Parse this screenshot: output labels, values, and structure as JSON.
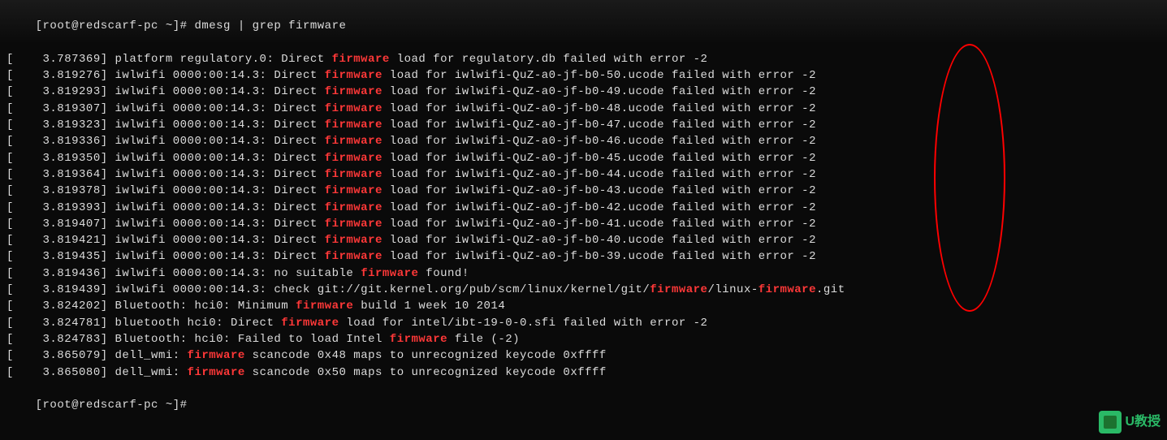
{
  "prompt": {
    "user_host": "[root@redscarf-pc ~]#",
    "command": "dmesg | grep firmware"
  },
  "lines": [
    {
      "time": "3.787369",
      "pre": "platform regulatory.0: Direct ",
      "hl": "firmware",
      "post": " load for regulatory.db failed with error -2"
    },
    {
      "time": "3.819276",
      "pre": "iwlwifi 0000:00:14.3: Direct ",
      "hl": "firmware",
      "post": " load for iwlwifi-QuZ-a0-jf-b0-50.ucode failed with error -2"
    },
    {
      "time": "3.819293",
      "pre": "iwlwifi 0000:00:14.3: Direct ",
      "hl": "firmware",
      "post": " load for iwlwifi-QuZ-a0-jf-b0-49.ucode failed with error -2"
    },
    {
      "time": "3.819307",
      "pre": "iwlwifi 0000:00:14.3: Direct ",
      "hl": "firmware",
      "post": " load for iwlwifi-QuZ-a0-jf-b0-48.ucode failed with error -2"
    },
    {
      "time": "3.819323",
      "pre": "iwlwifi 0000:00:14.3: Direct ",
      "hl": "firmware",
      "post": " load for iwlwifi-QuZ-a0-jf-b0-47.ucode failed with error -2"
    },
    {
      "time": "3.819336",
      "pre": "iwlwifi 0000:00:14.3: Direct ",
      "hl": "firmware",
      "post": " load for iwlwifi-QuZ-a0-jf-b0-46.ucode failed with error -2"
    },
    {
      "time": "3.819350",
      "pre": "iwlwifi 0000:00:14.3: Direct ",
      "hl": "firmware",
      "post": " load for iwlwifi-QuZ-a0-jf-b0-45.ucode failed with error -2"
    },
    {
      "time": "3.819364",
      "pre": "iwlwifi 0000:00:14.3: Direct ",
      "hl": "firmware",
      "post": " load for iwlwifi-QuZ-a0-jf-b0-44.ucode failed with error -2"
    },
    {
      "time": "3.819378",
      "pre": "iwlwifi 0000:00:14.3: Direct ",
      "hl": "firmware",
      "post": " load for iwlwifi-QuZ-a0-jf-b0-43.ucode failed with error -2"
    },
    {
      "time": "3.819393",
      "pre": "iwlwifi 0000:00:14.3: Direct ",
      "hl": "firmware",
      "post": " load for iwlwifi-QuZ-a0-jf-b0-42.ucode failed with error -2"
    },
    {
      "time": "3.819407",
      "pre": "iwlwifi 0000:00:14.3: Direct ",
      "hl": "firmware",
      "post": " load for iwlwifi-QuZ-a0-jf-b0-41.ucode failed with error -2"
    },
    {
      "time": "3.819421",
      "pre": "iwlwifi 0000:00:14.3: Direct ",
      "hl": "firmware",
      "post": " load for iwlwifi-QuZ-a0-jf-b0-40.ucode failed with error -2"
    },
    {
      "time": "3.819435",
      "pre": "iwlwifi 0000:00:14.3: Direct ",
      "hl": "firmware",
      "post": " load for iwlwifi-QuZ-a0-jf-b0-39.ucode failed with error -2"
    },
    {
      "time": "3.819436",
      "pre": "iwlwifi 0000:00:14.3: no suitable ",
      "hl": "firmware",
      "post": " found!"
    },
    {
      "time": "3.819439",
      "pre": "iwlwifi 0000:00:14.3: check git://git.kernel.org/pub/scm/linux/kernel/git/",
      "hl": "firmware",
      "post": "/linux-",
      "hl2": "firmware",
      "post2": ".git"
    },
    {
      "time": "3.824202",
      "pre": "Bluetooth: hci0: Minimum ",
      "hl": "firmware",
      "post": " build 1 week 10 2014"
    },
    {
      "time": "3.824781",
      "pre": "bluetooth hci0: Direct ",
      "hl": "firmware",
      "post": " load for intel/ibt-19-0-0.sfi failed with error -2"
    },
    {
      "time": "3.824783",
      "pre": "Bluetooth: hci0: Failed to load Intel ",
      "hl": "firmware",
      "post": " file (-2)"
    },
    {
      "time": "3.865079",
      "pre": "dell_wmi: ",
      "hl": "firmware",
      "post": " scancode 0x48 maps to unrecognized keycode 0xffff"
    },
    {
      "time": "3.865080",
      "pre": "dell_wmi: ",
      "hl": "firmware",
      "post": " scancode 0x50 maps to unrecognized keycode 0xffff"
    }
  ],
  "prompt_end": "[root@redscarf-pc ~]#",
  "watermark_text": "U教授"
}
